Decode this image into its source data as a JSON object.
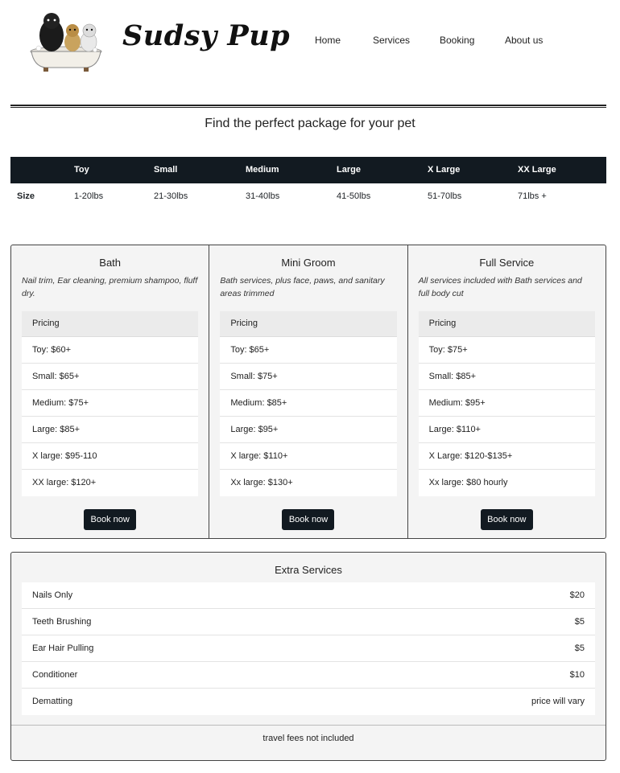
{
  "header": {
    "brand": "Sudsy Pup",
    "nav": [
      "Home",
      "Services",
      "Booking",
      "About us"
    ]
  },
  "page_title": "Find the perfect package for your pet",
  "size_table": {
    "columns": [
      "Toy",
      "Small",
      "Medium",
      "Large",
      "X Large",
      "XX Large"
    ],
    "row_label": "Size",
    "values": [
      "1-20lbs",
      "21-30lbs",
      "31-40lbs",
      "41-50lbs",
      "51-70lbs",
      "71lbs +"
    ]
  },
  "packages": [
    {
      "title": "Bath",
      "description": "Nail trim, Ear cleaning, premium shampoo, fluff dry.",
      "pricing_label": "Pricing",
      "prices": [
        "Toy: $60+",
        "Small: $65+",
        "Medium: $75+",
        "Large: $85+",
        "X large: $95-110",
        "XX large: $120+"
      ],
      "button": "Book now"
    },
    {
      "title": "Mini Groom",
      "description": "Bath services, plus face, paws, and sanitary areas trimmed",
      "pricing_label": "Pricing",
      "prices": [
        "Toy: $65+",
        "Small: $75+",
        "Medium: $85+",
        "Large: $95+",
        "X large: $110+",
        "Xx large: $130+"
      ],
      "button": "Book now"
    },
    {
      "title": "Full Service",
      "description": "All services included with Bath services and full body cut",
      "pricing_label": "Pricing",
      "prices": [
        "Toy: $75+",
        "Small: $85+",
        "Medium: $95+",
        "Large: $110+",
        "X Large: $120-$135+",
        "Xx large: $80 hourly"
      ],
      "button": "Book now"
    }
  ],
  "extras": {
    "title": "Extra Services",
    "items": [
      {
        "name": "Nails Only",
        "price": "$20"
      },
      {
        "name": "Teeth Brushing",
        "price": "$5"
      },
      {
        "name": "Ear Hair Pulling",
        "price": "$5"
      },
      {
        "name": "Conditioner",
        "price": "$10"
      },
      {
        "name": "Dematting",
        "price": "price will vary"
      }
    ],
    "footer": "travel fees not included"
  },
  "colors": {
    "dark": "#121a21",
    "card_bg": "#f4f4f4",
    "pricing_head_bg": "#ebebeb"
  }
}
